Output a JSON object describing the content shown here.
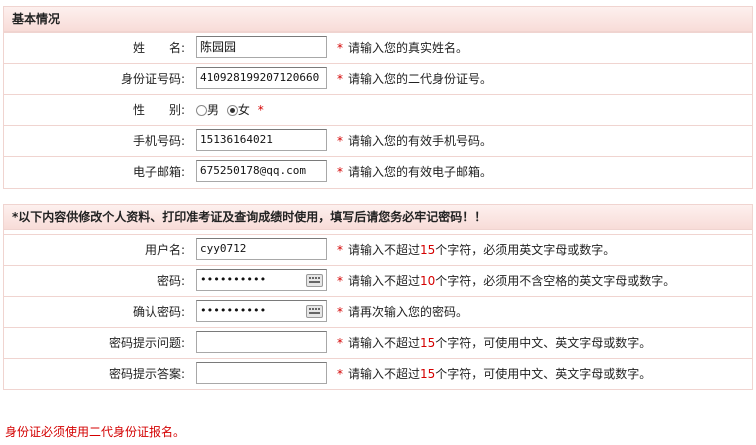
{
  "section1": {
    "title": "基本情况",
    "name": {
      "label": "姓　　名:",
      "value": "陈园园",
      "hint": "请输入您的真实姓名。"
    },
    "idcard": {
      "label": "身份证号码:",
      "value": "410928199207120660",
      "hint": "请输入您的二代身份证号。"
    },
    "gender": {
      "label": "性　　别:",
      "male": "男",
      "female": "女",
      "selected": "女"
    },
    "phone": {
      "label": "手机号码:",
      "value": "15136164021",
      "hint": "请输入您的有效手机号码。"
    },
    "email": {
      "label": "电子邮箱:",
      "value": "675250178@qq.com",
      "hint": "请输入您的有效电子邮箱。"
    }
  },
  "section2": {
    "title": "*以下内容供修改个人资料、打印准考证及查询成绩时使用，填写后请您务必牢记密码！！",
    "username": {
      "label": "用户名:",
      "value": "cyy0712",
      "hint_a": "请输入不超过",
      "hint_num": "15",
      "hint_b": "个字符，必须用英文字母或数字。"
    },
    "password": {
      "label": "密码:",
      "value": "••••••••••",
      "hint_a": "请输入不超过",
      "hint_num": "10",
      "hint_b": "个字符，必须用不含空格的英文字母或数字。"
    },
    "confirm": {
      "label": "确认密码:",
      "value": "••••••••••",
      "hint": "请再次输入您的密码。"
    },
    "question": {
      "label": "密码提示问题:",
      "value": "",
      "hint_a": "请输入不超过",
      "hint_num": "15",
      "hint_b": "个字符，可使用中文、英文字母或数字。"
    },
    "answer": {
      "label": "密码提示答案:",
      "value": "",
      "hint_a": "请输入不超过",
      "hint_num": "15",
      "hint_b": "个字符，可使用中文、英文字母或数字。"
    }
  },
  "star": "*",
  "footer_note": "身份证必须使用二代身份证报名。",
  "icons": {
    "keyboard": "keyboard-icon"
  },
  "colors": {
    "accent_red": "#d40000",
    "border_pink": "#f0d4d0"
  }
}
